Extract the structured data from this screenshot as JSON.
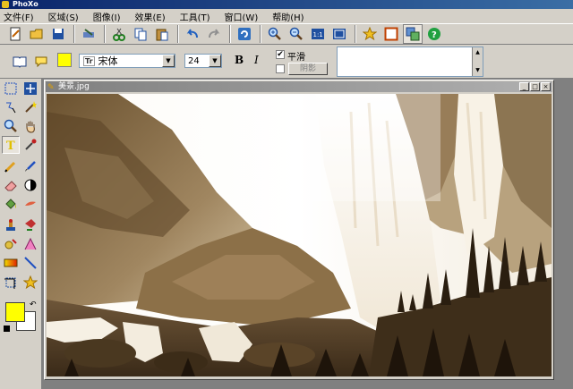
{
  "app": {
    "title": "PhoXo"
  },
  "menu": [
    "文件(F)",
    "区域(S)",
    "图像(I)",
    "效果(E)",
    "工具(T)",
    "窗口(W)",
    "帮助(H)"
  ],
  "toolbar": {
    "icons": [
      "new-icon",
      "open-icon",
      "save-icon",
      "scan-icon",
      "cut-icon",
      "copy-icon",
      "paste-icon",
      "undo-icon",
      "redo-icon",
      "refresh-icon",
      "zoom-in-icon",
      "zoom-out-icon",
      "actual-size-icon",
      "fit-window-icon",
      "favorite-icon",
      "frame-icon",
      "layers-icon",
      "help-icon"
    ]
  },
  "text_options": {
    "font": "宋体",
    "font_glyph": "Tr",
    "size": "24",
    "bold": "B",
    "italic": "I",
    "smooth_label": "平滑",
    "smooth_checked": "✔",
    "shadow_label": "阴影",
    "color": "#ffff00"
  },
  "document": {
    "title": "美景.jpg"
  },
  "colors": {
    "foreground": "#ffff00",
    "background": "#ffffff",
    "title_active": "#0a246a"
  }
}
